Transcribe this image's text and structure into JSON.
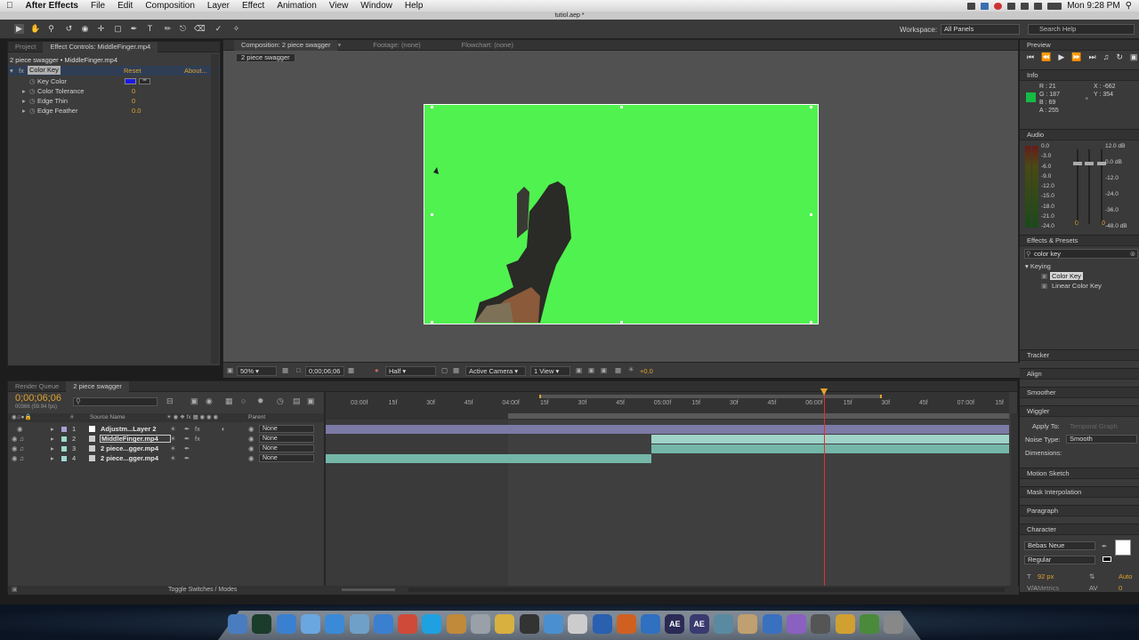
{
  "menubar": {
    "apple": "",
    "app_name": "After Effects",
    "items": [
      "File",
      "Edit",
      "Composition",
      "Layer",
      "Effect",
      "Animation",
      "View",
      "Window",
      "Help"
    ],
    "clock": "Mon 9:28 PM"
  },
  "window_title": "tutiol.aep *",
  "toolbar": {
    "workspace_label": "Workspace:",
    "workspace_value": "All Panels",
    "search_placeholder": "Search Help"
  },
  "effect_panel": {
    "tabs": [
      "Project",
      "Effect Controls: MiddleFinger.mp4"
    ],
    "breadcrumb": "2 piece swagger • MiddleFinger.mp4",
    "effect_name": "Color Key",
    "reset": "Reset",
    "about": "About...",
    "params": [
      {
        "label": "Key Color",
        "value": ""
      },
      {
        "label": "Color Tolerance",
        "value": "0"
      },
      {
        "label": "Edge Thin",
        "value": "0"
      },
      {
        "label": "Edge Feather",
        "value": "0.0"
      }
    ],
    "key_color": "#1a1ae6"
  },
  "comp_panel": {
    "tabs": [
      "Composition: 2 piece swagger",
      "Footage: (none)",
      "Flowchart: (none)"
    ],
    "sub_tab": "2 piece swagger",
    "zoom": "50%",
    "timecode": "0;00;06;06",
    "resolution": "Half",
    "camera": "Active Camera",
    "views": "1 View",
    "exposure": "+0.0",
    "background_color": "#50f250"
  },
  "right": {
    "preview": "Preview",
    "info": "Info",
    "info_values": {
      "r": "R : 21",
      "g": "G : 187",
      "b": "B : 69",
      "a": "A : 255",
      "x": "X : -662",
      "y": "Y : 354"
    },
    "info_swatch": "#15bb45",
    "audio": "Audio",
    "audio_left_scale": [
      "0.0",
      "-3.0",
      "-6.0",
      "-9.0",
      "-12.0",
      "-15.0",
      "-18.0",
      "-21.0",
      "-24.0"
    ],
    "audio_right_scale": [
      "12.0 dB",
      "0.0 dB",
      "-12.0",
      "-24.0",
      "-36.0",
      "-48.0 dB"
    ],
    "audio_zero_left": "0",
    "audio_zero_right": "0",
    "effects_presets": "Effects & Presets",
    "search_value": "color key",
    "folder": "Keying",
    "results": [
      "Color Key",
      "Linear Color Key"
    ],
    "tracker": "Tracker",
    "align": "Align",
    "smoother": "Smoother",
    "wiggler": "Wiggler",
    "apply_to_label": "Apply To:",
    "apply_to_value": "Temporal Graph",
    "noise_label": "Noise Type:",
    "noise_value": "Smooth",
    "dimensions_label": "Dimensions:",
    "motion_sketch": "Motion Sketch",
    "mask_interp": "Mask Interpolation",
    "paragraph": "Paragraph",
    "character": "Character",
    "font_name": "Bebas Neue",
    "font_style": "Regular",
    "font_size": "92 px",
    "leading": "Auto",
    "metrics": "Metrics",
    "tracking": "0"
  },
  "timeline": {
    "tabs": [
      "Render Queue",
      "2 piece swagger"
    ],
    "timecode": "0;00;06;06",
    "frame_info": "00366 (59.94 fps)",
    "col_source": "Source Name",
    "col_parent": "Parent",
    "col_num": "#",
    "ruler": [
      "03:00f",
      "15f",
      "30f",
      "45f",
      "04:00f",
      "15f",
      "30f",
      "45f",
      "05:00f",
      "15f",
      "30f",
      "45f",
      "06:00f",
      "15f",
      "30f",
      "45f",
      "07:00f",
      "15f"
    ],
    "layers": [
      {
        "num": "1",
        "name": "Adjustm...Layer 2",
        "parent": "None"
      },
      {
        "num": "2",
        "name": "MiddleFinger.mp4",
        "parent": "None"
      },
      {
        "num": "3",
        "name": "2 piece...gger.mp4",
        "parent": "None"
      },
      {
        "num": "4",
        "name": "2 piece...gger.mp4",
        "parent": "None"
      }
    ],
    "toggle_label": "Toggle Switches / Modes"
  },
  "dock": {
    "items": [
      "Finder",
      "Terminal",
      "iTunes",
      "Messages",
      "Safari",
      "Preview",
      "Music",
      "Chrome",
      "Skype",
      "Brush",
      "Gear",
      "Notes",
      "Clapper",
      "Mail",
      "Calc",
      "Word",
      "Fire",
      "Earth",
      "AE",
      "AE",
      "Tool",
      "Script",
      "Pen",
      "Paint",
      "Film",
      "Sun",
      "Tree",
      "Trash"
    ]
  }
}
